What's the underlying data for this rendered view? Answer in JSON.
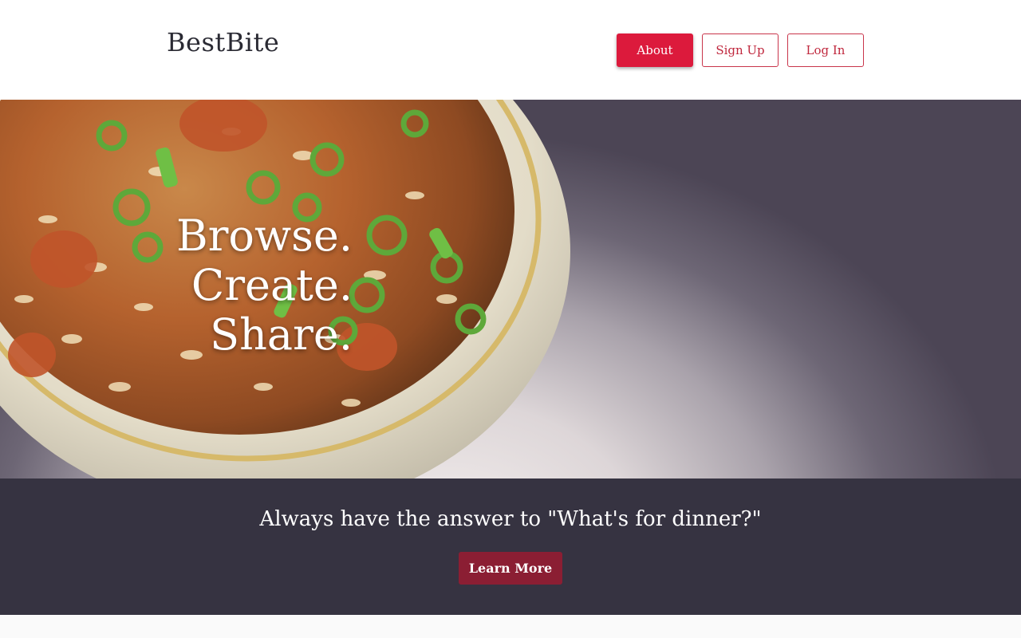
{
  "header": {
    "logo": "BestBite",
    "nav": {
      "about": "About",
      "sign_up": "Sign Up",
      "log_in": "Log In"
    }
  },
  "hero": {
    "lines": [
      "Browse.",
      "Create.",
      "Share."
    ],
    "image": "bowl-of-jambalaya-with-green-onions"
  },
  "banner": {
    "tagline": "Always have the answer to \"What's for dinner?\"",
    "cta": "Learn More"
  },
  "colors": {
    "brand_red": "#dc1a3c",
    "cta_dark_red": "#8b1e33",
    "banner_bg": "#363341"
  }
}
